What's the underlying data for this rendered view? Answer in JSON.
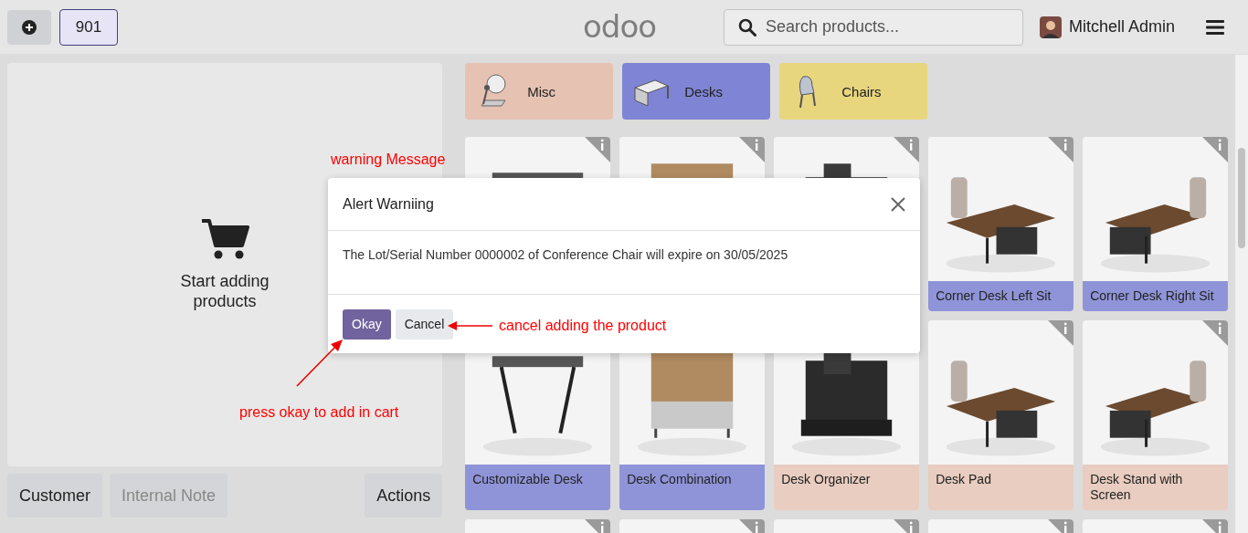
{
  "top_bar": {
    "order_number": "901",
    "logo": "odoo",
    "search": {
      "placeholder": "Search products..."
    },
    "user": "Mitchell Admin"
  },
  "order_panel": {
    "empty_message": "Start adding products"
  },
  "order_actions": [
    {
      "label": "Customer",
      "disabled": false
    },
    {
      "label": "Internal Note",
      "disabled": true
    },
    {
      "label": "Actions",
      "disabled": false
    }
  ],
  "categories": [
    {
      "label": "Misc",
      "color": "#e6c2b2"
    },
    {
      "label": "Desks",
      "color": "#7f85d4"
    },
    {
      "label": "Chairs",
      "color": "#e8d67e"
    }
  ],
  "products": [
    {
      "kind": "picture",
      "info": true
    },
    {
      "kind": "picture",
      "info": true
    },
    {
      "kind": "picture",
      "info": true
    },
    {
      "kind": "product",
      "name": "Corner Desk Left Sit",
      "color": "#8f94d8",
      "info": true
    },
    {
      "kind": "product",
      "name": "Corner Desk Right Sit",
      "color": "#8f94d8",
      "info": true
    },
    {
      "kind": "product",
      "name": "Customizable Desk",
      "color": "#8f94d8",
      "info": false
    },
    {
      "kind": "product",
      "name": "Desk Combination",
      "color": "#8f94d8",
      "info": false
    },
    {
      "kind": "product",
      "name": "Desk Organizer",
      "color": "#e8cdc0",
      "info": false
    },
    {
      "kind": "product",
      "name": "Desk Pad",
      "color": "#e8cdc0",
      "info": true
    },
    {
      "kind": "product",
      "name": "Desk Stand with Screen",
      "color": "#e8cdc0",
      "info": true
    },
    {
      "kind": "picture",
      "info": true
    },
    {
      "kind": "picture",
      "info": true
    },
    {
      "kind": "picture",
      "info": true
    },
    {
      "kind": "picture",
      "info": true
    },
    {
      "kind": "picture",
      "info": true
    }
  ],
  "dialog": {
    "title": "Alert Warniing",
    "message": "The Lot/Serial Number 0000002 of Conference Chair will expire on 30/05/2025",
    "buttons": [
      {
        "label": "Okay",
        "kind": "primary"
      },
      {
        "label": "Cancel",
        "kind": "secondary"
      }
    ]
  },
  "annotations": [
    {
      "text": "warning Message"
    },
    {
      "text": "cancel adding the product"
    },
    {
      "text": "press okay to add in cart"
    }
  ]
}
